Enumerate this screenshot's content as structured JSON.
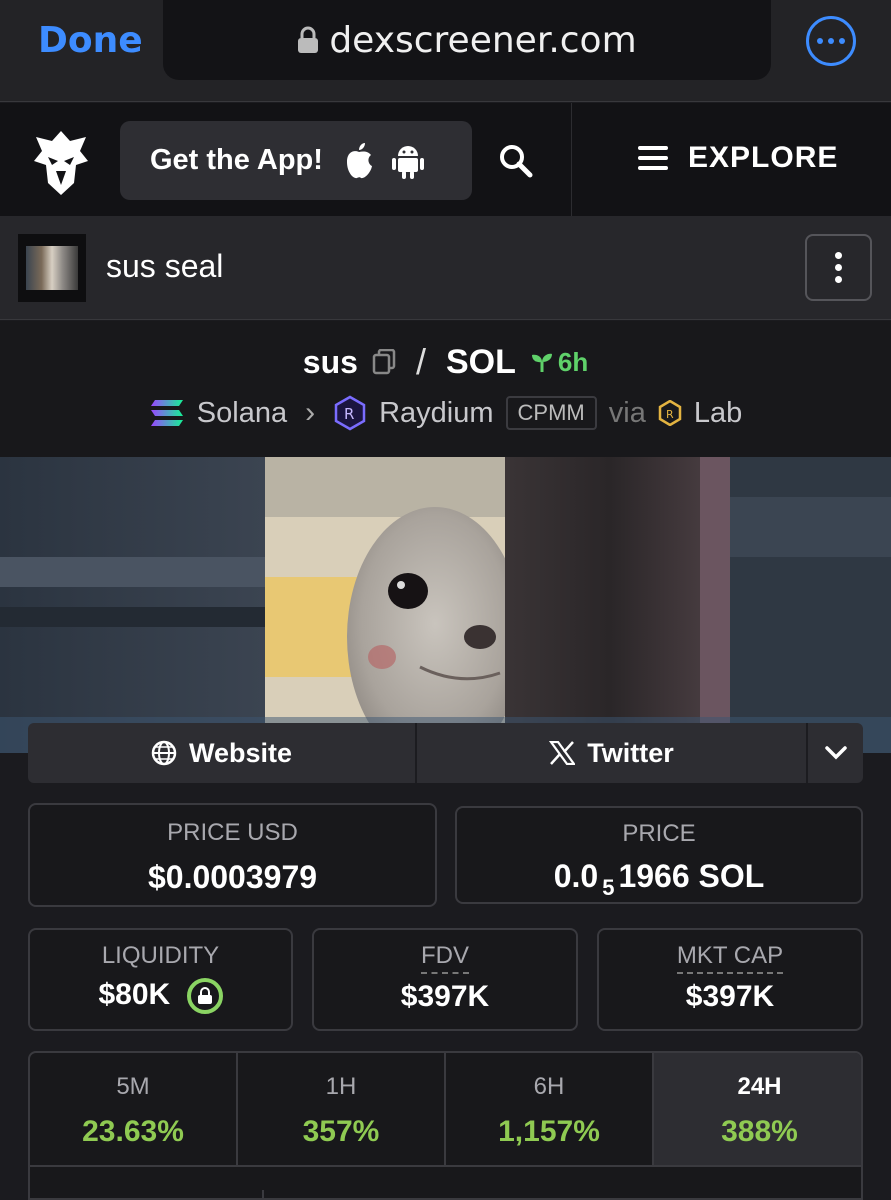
{
  "browser": {
    "done_label": "Done",
    "url": "dexscreener.com"
  },
  "header": {
    "get_app_label": "Get the App!",
    "explore_label": "EXPLORE"
  },
  "token": {
    "name": "sus seal"
  },
  "pair": {
    "base": "sus",
    "separator": "/",
    "quote": "SOL",
    "age": "6h",
    "chain": "Solana",
    "dex": "Raydium",
    "pool_type": "CPMM",
    "via": "via",
    "launchpad": "Lab"
  },
  "links": {
    "website_label": "Website",
    "twitter_label": "Twitter"
  },
  "stats": {
    "price_usd_label": "PRICE USD",
    "price_usd_value": "$0.0003979",
    "price_label": "PRICE",
    "price_prefix": "0.0",
    "price_zeros": "5",
    "price_digits": "1966 SOL",
    "liquidity_label": "LIQUIDITY",
    "liquidity_value": "$80K",
    "fdv_label": "FDV",
    "fdv_value": "$397K",
    "mktcap_label": "MKT CAP",
    "mktcap_value": "$397K"
  },
  "changes": [
    {
      "label": "5M",
      "value": "23.63%"
    },
    {
      "label": "1H",
      "value": "357%"
    },
    {
      "label": "6H",
      "value": "1,157%"
    },
    {
      "label": "24H",
      "value": "388%",
      "active": true
    }
  ],
  "colors": {
    "accent_blue": "#3d8cff",
    "positive_green": "#8fca52",
    "age_green": "#5fd16a"
  }
}
